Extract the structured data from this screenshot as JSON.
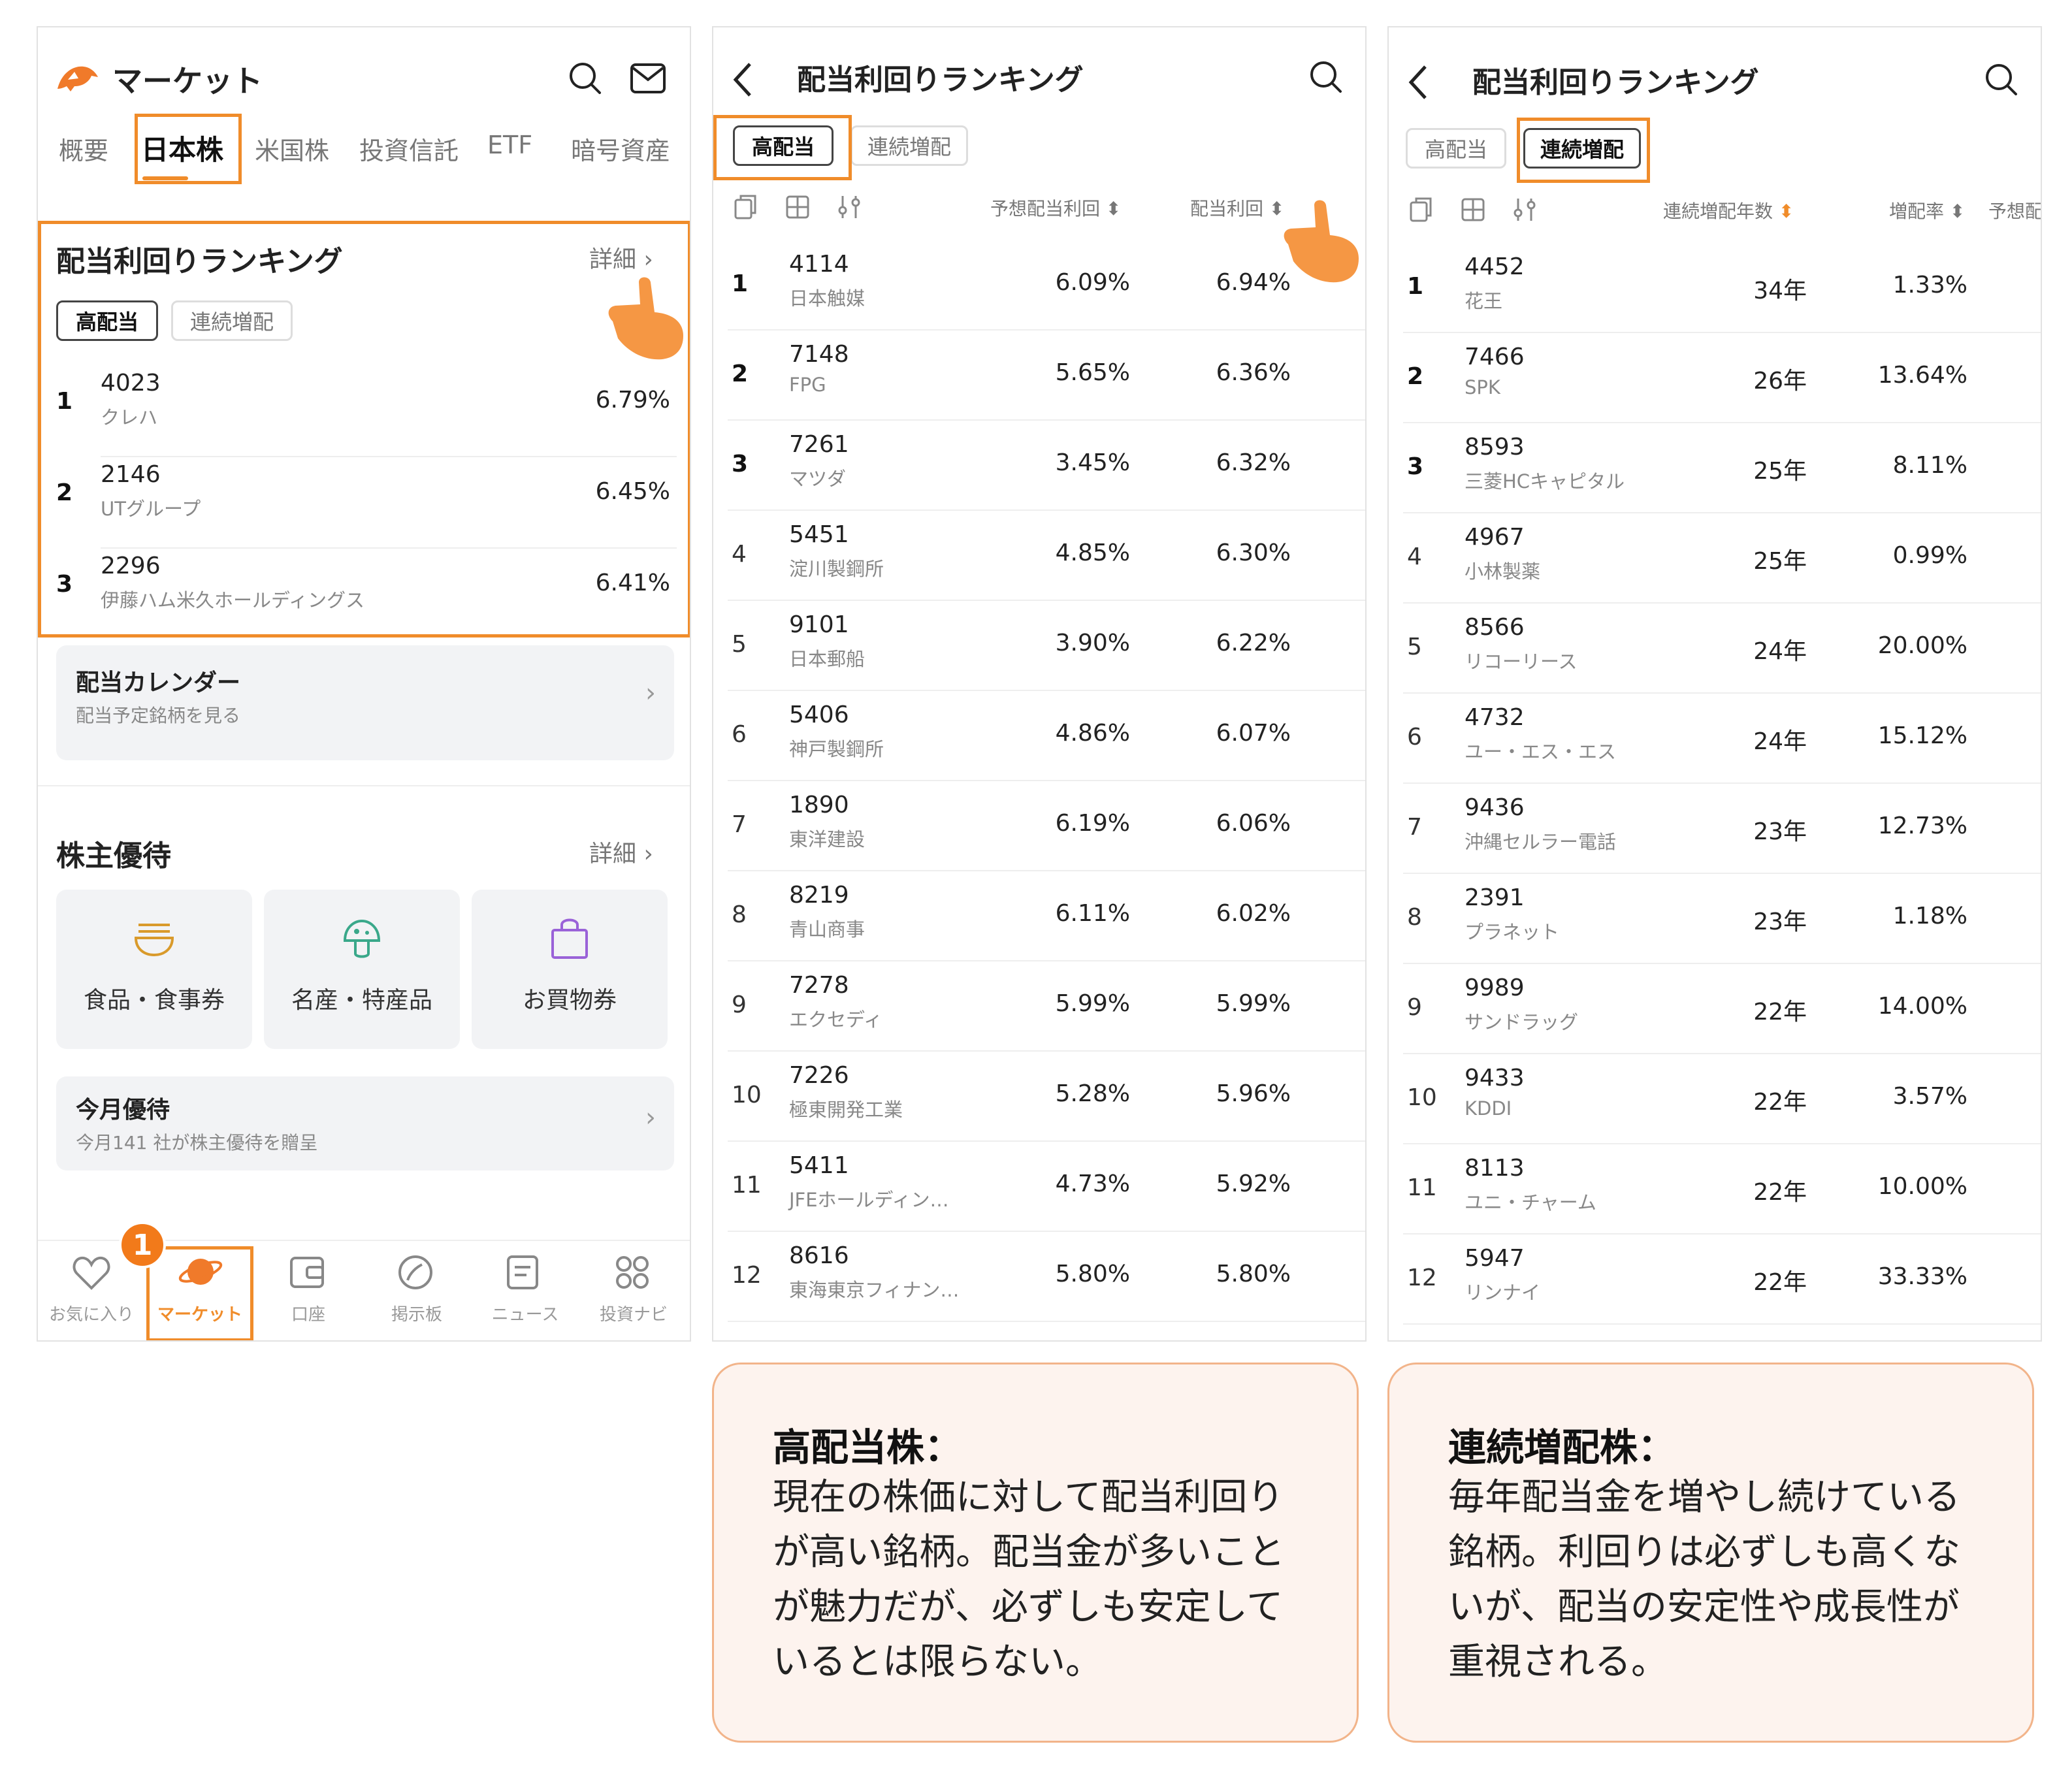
{
  "colors": {
    "accent": "#f08c2a",
    "badge": "#f27a1a",
    "callout_bg": "#fdf3ee",
    "callout_border": "#f2b48a"
  },
  "panel1": {
    "header": {
      "title": "マーケット"
    },
    "tabs": [
      "概要",
      "日本株",
      "米国株",
      "投資信託",
      "ETF",
      "暗号資産"
    ],
    "active_tab": "日本株",
    "ranking": {
      "title": "配当利回りランキング",
      "detail": "詳細",
      "pills": [
        "高配当",
        "連続増配"
      ],
      "rows": [
        {
          "rank": "1",
          "code": "4023",
          "name": "クレハ",
          "value": "6.79%"
        },
        {
          "rank": "2",
          "code": "2146",
          "name": "UTグループ",
          "value": "6.45%"
        },
        {
          "rank": "3",
          "code": "2296",
          "name": "伊藤ハム米久ホールディングス",
          "value": "6.41%"
        }
      ]
    },
    "calendar": {
      "title": "配当カレンダー",
      "sub": "配当予定銘柄を見る"
    },
    "benefits": {
      "title": "株主優待",
      "detail": "詳細",
      "categories": [
        "食品・食事券",
        "名産・特産品",
        "お買物券"
      ]
    },
    "monthly": {
      "title": "今月優待",
      "sub": "今月141 社が株主優待を贈呈"
    },
    "nav": [
      "お気に入り",
      "マーケット",
      "口座",
      "掲示板",
      "ニュース",
      "投資ナビ"
    ],
    "step_badge": "1"
  },
  "panel2": {
    "title": "配当利回りランキング",
    "pills": [
      "高配当",
      "連続増配"
    ],
    "columns": [
      "予想配当利回",
      "配当利回"
    ],
    "rows": [
      {
        "rank": "1",
        "code": "4114",
        "name": "日本触媒",
        "v1": "6.09%",
        "v2": "6.94%"
      },
      {
        "rank": "2",
        "code": "7148",
        "name": "FPG",
        "v1": "5.65%",
        "v2": "6.36%"
      },
      {
        "rank": "3",
        "code": "7261",
        "name": "マツダ",
        "v1": "3.45%",
        "v2": "6.32%"
      },
      {
        "rank": "4",
        "code": "5451",
        "name": "淀川製鋼所",
        "v1": "4.85%",
        "v2": "6.30%"
      },
      {
        "rank": "5",
        "code": "9101",
        "name": "日本郵船",
        "v1": "3.90%",
        "v2": "6.22%"
      },
      {
        "rank": "6",
        "code": "5406",
        "name": "神戸製鋼所",
        "v1": "4.86%",
        "v2": "6.07%"
      },
      {
        "rank": "7",
        "code": "1890",
        "name": "東洋建設",
        "v1": "6.19%",
        "v2": "6.06%"
      },
      {
        "rank": "8",
        "code": "8219",
        "name": "青山商事",
        "v1": "6.11%",
        "v2": "6.02%"
      },
      {
        "rank": "9",
        "code": "7278",
        "name": "エクセディ",
        "v1": "5.99%",
        "v2": "5.99%"
      },
      {
        "rank": "10",
        "code": "7226",
        "name": "極東開発工業",
        "v1": "5.28%",
        "v2": "5.96%"
      },
      {
        "rank": "11",
        "code": "5411",
        "name": "JFEホールディン…",
        "v1": "4.73%",
        "v2": "5.92%"
      },
      {
        "rank": "12",
        "code": "8616",
        "name": "東海東京フィナン…",
        "v1": "5.80%",
        "v2": "5.80%"
      }
    ]
  },
  "panel3": {
    "title": "配当利回りランキング",
    "pills": [
      "高配当",
      "連続増配"
    ],
    "columns": [
      "連続増配年数",
      "増配率",
      "予想配"
    ],
    "rows": [
      {
        "rank": "1",
        "code": "4452",
        "name": "花王",
        "v1": "34年",
        "v2": "1.33%"
      },
      {
        "rank": "2",
        "code": "7466",
        "name": "SPK",
        "v1": "26年",
        "v2": "13.64%"
      },
      {
        "rank": "3",
        "code": "8593",
        "name": "三菱HCキャピタル",
        "v1": "25年",
        "v2": "8.11%"
      },
      {
        "rank": "4",
        "code": "4967",
        "name": "小林製薬",
        "v1": "25年",
        "v2": "0.99%"
      },
      {
        "rank": "5",
        "code": "8566",
        "name": "リコーリース",
        "v1": "24年",
        "v2": "20.00%"
      },
      {
        "rank": "6",
        "code": "4732",
        "name": "ユー・エス・エス",
        "v1": "24年",
        "v2": "15.12%"
      },
      {
        "rank": "7",
        "code": "9436",
        "name": "沖縄セルラー電話",
        "v1": "23年",
        "v2": "12.73%"
      },
      {
        "rank": "8",
        "code": "2391",
        "name": "プラネット",
        "v1": "23年",
        "v2": "1.18%"
      },
      {
        "rank": "9",
        "code": "9989",
        "name": "サンドラッグ",
        "v1": "22年",
        "v2": "14.00%"
      },
      {
        "rank": "10",
        "code": "9433",
        "name": "KDDI",
        "v1": "22年",
        "v2": "3.57%"
      },
      {
        "rank": "11",
        "code": "8113",
        "name": "ユニ・チャーム",
        "v1": "22年",
        "v2": "10.00%"
      },
      {
        "rank": "12",
        "code": "5947",
        "name": "リンナイ",
        "v1": "22年",
        "v2": "33.33%"
      }
    ]
  },
  "callouts": [
    {
      "title": "高配当株：",
      "body": " 現在の株価に対して配当利回りが高い銘柄。配当金が多いことが魅力だが、必ずしも安定しているとは限らない。"
    },
    {
      "title": "連続増配株：",
      "body": "毎年配当金を増やし続けている銘柄。利回りは必ずしも高くないが、配当の安定性や成長性が重視される。"
    }
  ]
}
